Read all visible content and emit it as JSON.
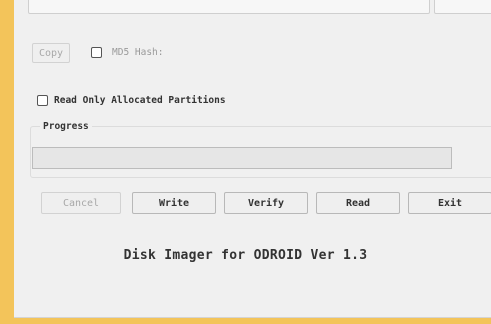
{
  "copy_button": {
    "label": "Copy"
  },
  "md5": {
    "label": "MD5 Hash:",
    "checked": false
  },
  "read_only_partitions": {
    "label": "Read Only Allocated Partitions",
    "checked": false
  },
  "progress": {
    "title": "Progress",
    "value": 0
  },
  "buttons": {
    "cancel": "Cancel",
    "write": "Write",
    "verify": "Verify",
    "read": "Read",
    "exit": "Exit"
  },
  "footer": {
    "text": "Disk Imager for ODROID Ver 1.3"
  },
  "colors": {
    "accent_border": "#f3c45a",
    "window_bg": "#f0f0f0"
  }
}
